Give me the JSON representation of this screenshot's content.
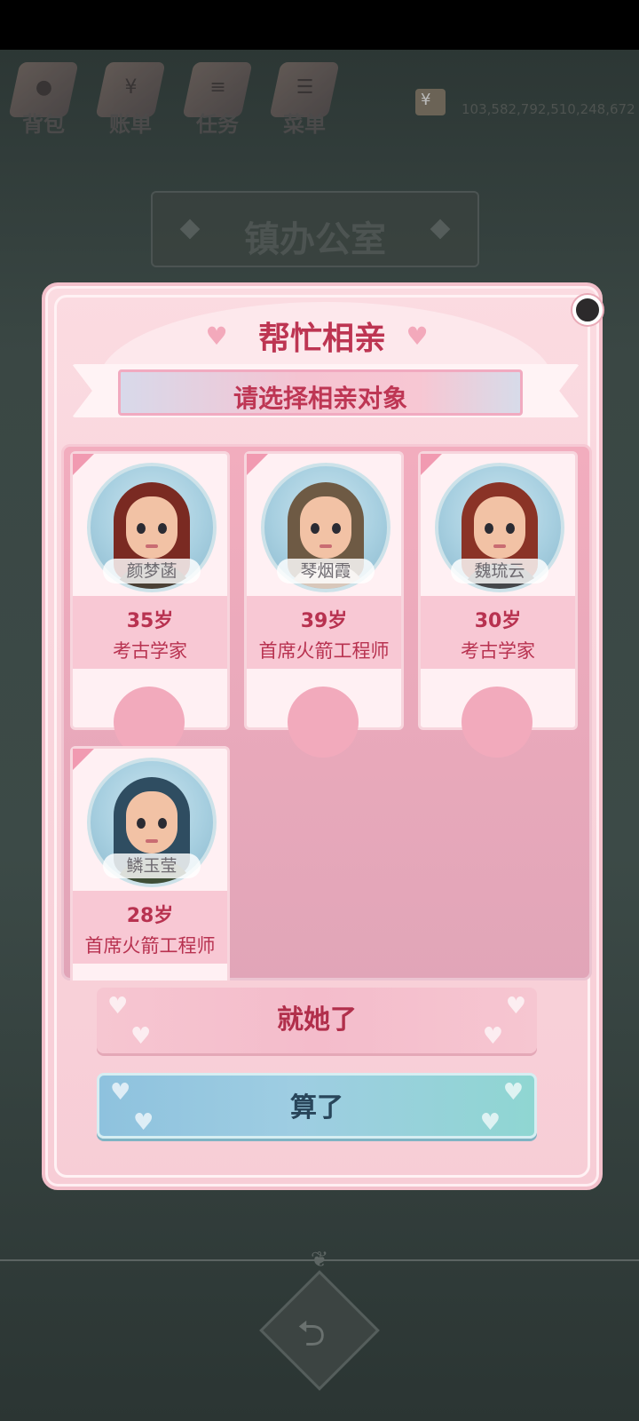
{
  "toolbar": {
    "items": [
      {
        "label": "背包",
        "icon": "bag-icon"
      },
      {
        "label": "账单",
        "icon": "bill-icon"
      },
      {
        "label": "任务",
        "icon": "task-icon"
      },
      {
        "label": "菜单",
        "icon": "menu-icon"
      }
    ],
    "money": "103,582,792,510,248,672",
    "currency_symbol": "¥"
  },
  "location": {
    "title": "镇办公室"
  },
  "dialog": {
    "title": "帮忙相亲",
    "subtitle": "请选择相亲对象",
    "candidates": [
      {
        "name": "颜梦菡",
        "age": "35岁",
        "job": "考古学家",
        "hair": "#7a2a22",
        "body": "#4a4035"
      },
      {
        "name": "琴烟霞",
        "age": "39岁",
        "job": "首席火箭工程师",
        "hair": "#6e5a44",
        "body": "#d8c7ba"
      },
      {
        "name": "魏琉云",
        "age": "30岁",
        "job": "考古学家",
        "hair": "#8a3326",
        "body": "#45474a"
      },
      {
        "name": "鳞玉莹",
        "age": "28岁",
        "job": "首席火箭工程师",
        "hair": "#2f4d61",
        "body": "#3f4e36"
      }
    ],
    "confirm_label": "就她了",
    "cancel_label": "算了"
  },
  "nav": {
    "back_glyph": "⮌"
  },
  "colors": {
    "accent": "#bd3552",
    "panel": "#fbdbe1",
    "cancel": "#9ecde2"
  }
}
